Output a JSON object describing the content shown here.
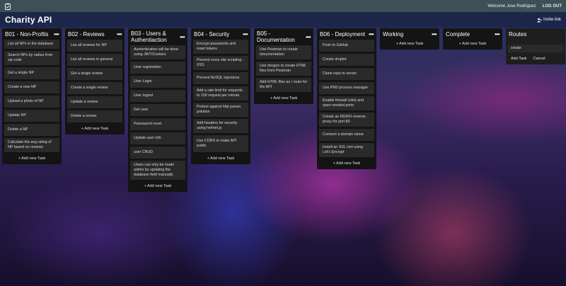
{
  "topbar": {
    "welcome": "Welcome Jose Rodriguez",
    "logout": "LOG OUT",
    "logo_icon": "clipboard-check-icon"
  },
  "board": {
    "title": "Charity API",
    "invite": "Invite link"
  },
  "lists": [
    {
      "title": "B01 - Non-Profits",
      "cards": [
        "List all NPs in the database",
        "Search NPs by radius from zip code",
        "Get a single NP",
        "Create a new NP",
        "Upload a photo of NP",
        "Update NP",
        "Delete a NP",
        "Calculate the avg rating of NP based on reviews"
      ],
      "add": "+ Add new Task"
    },
    {
      "title": "B02 - Reviews",
      "cards": [
        "List all reviews for NP",
        "List all reviews in general",
        "Get a single review",
        "Create a single review",
        "Update a review",
        "Delete a review"
      ],
      "add": "+ Add new Task"
    },
    {
      "title": "B03 - Users & Authentiaction",
      "cards": [
        "Auntentication will be done using JWT/Cookies",
        "User registration",
        "User Login",
        "User logout",
        "Get user",
        "Passsword reset",
        "Update user info",
        "user CRUD",
        "Users can only be made admin by updating the database field manually"
      ],
      "add": "+ Add new Task"
    },
    {
      "title": "B04 - Security",
      "cards": [
        "Encrypt passwords and reset tokens",
        "Prevent cross site scripting - XSS",
        "Prevent NoSQL injections",
        "Add a rate limit for requests to 100 request per minute",
        "Protect against http param polution",
        "Add headers for security using helmet.js",
        "Use CORS to make API public"
      ],
      "add": "+ Add new Task"
    },
    {
      "title": "B05 - Documentation",
      "cards": [
        "Use Postman to create documentation",
        "Use docgen to create HTML files from Postman",
        "Add HTML files as / route for the API"
      ],
      "add": "+ Add new Task"
    },
    {
      "title": "B06 - Deployment",
      "cards": [
        "Push to GitHub",
        "Create droplet",
        "Clone repo to server",
        "Use PM2 process manager",
        "Enable firewall (ufw) and open needed ports",
        "Create an NGINX reverse proxy for port 80",
        "Connect a domain name",
        "Install an SSL cert using Let's Encrypt"
      ],
      "add": "+ Add new Task"
    },
    {
      "title": "Working",
      "cards": [],
      "add": "+ Add new Task"
    },
    {
      "title": "Complete",
      "cards": [],
      "add": "+ Add new Task"
    }
  ],
  "routes": {
    "title": "Routes",
    "input_value": "create",
    "add": "Add Task",
    "cancel": "Cancel"
  }
}
